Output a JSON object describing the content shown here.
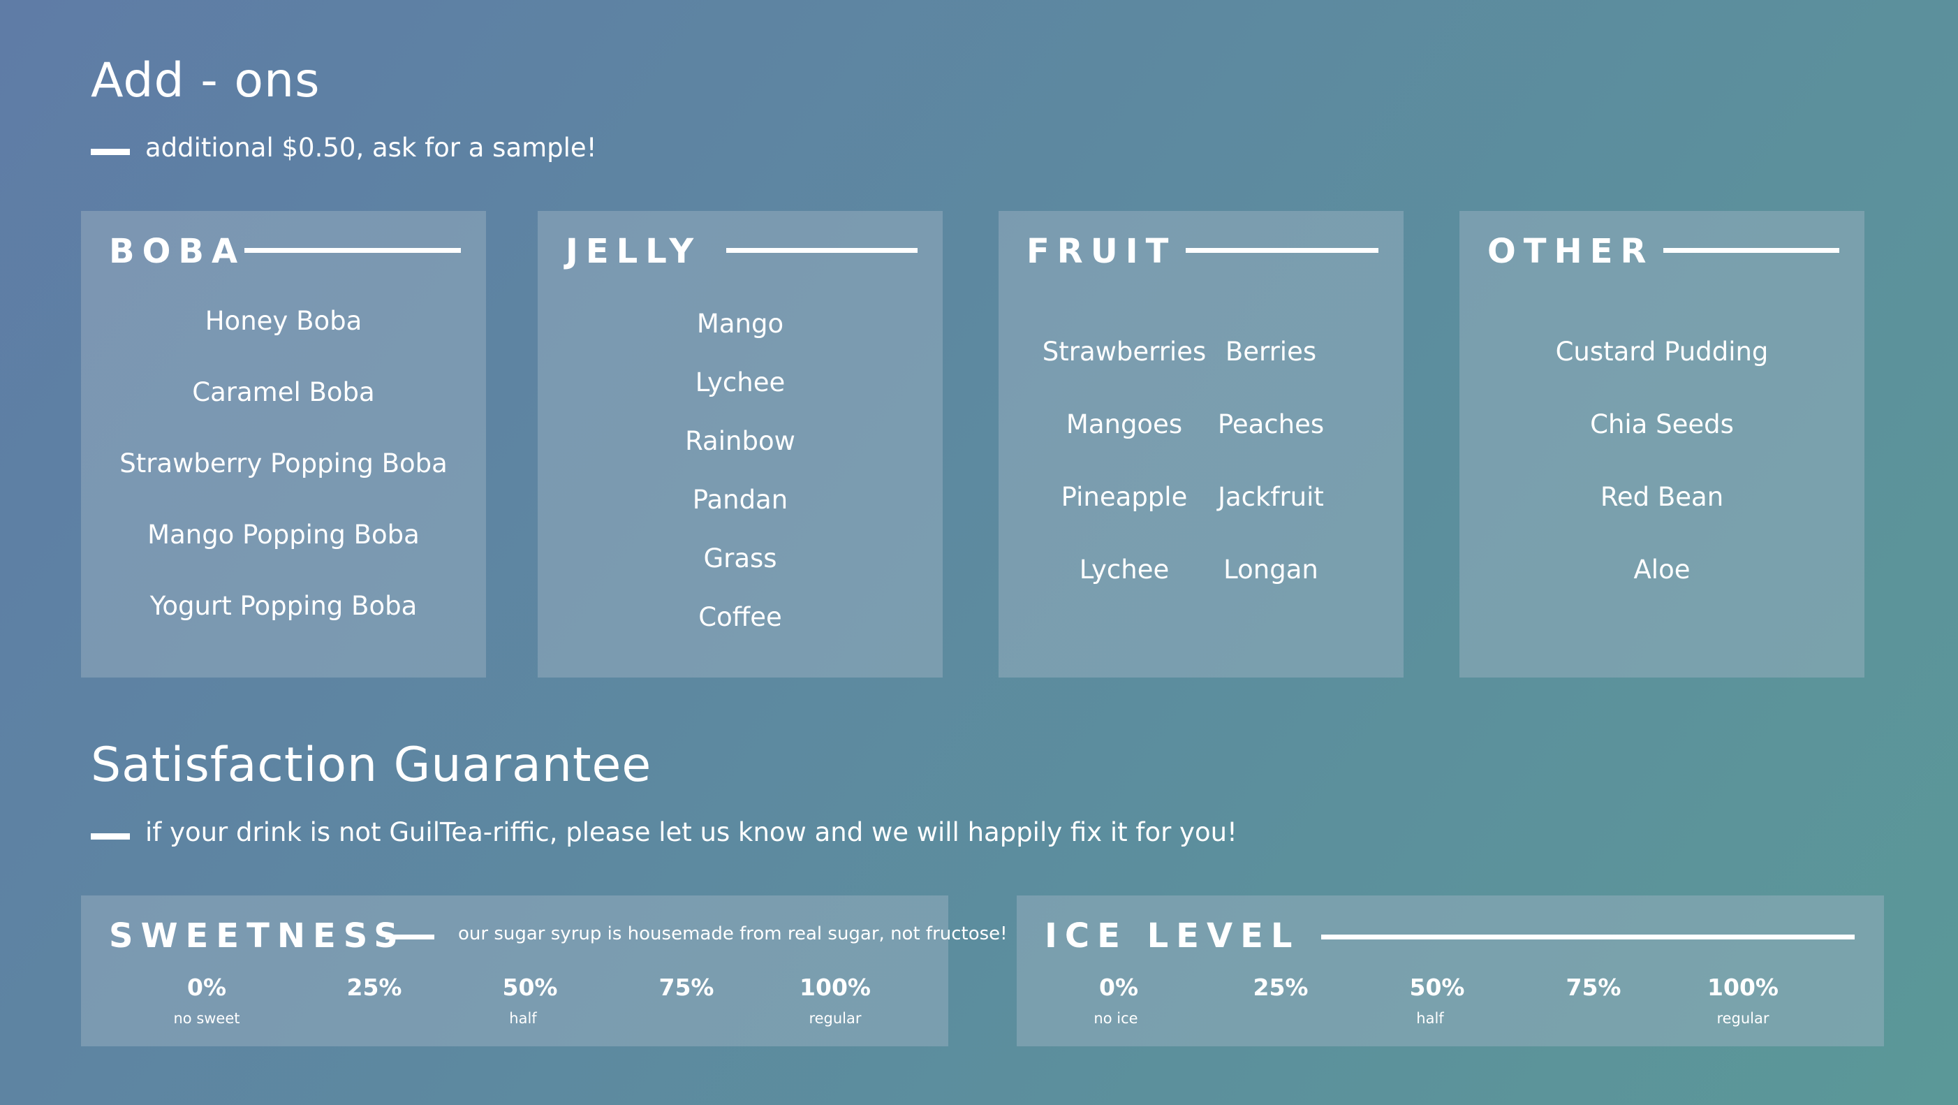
{
  "addons": {
    "title": "Add - ons",
    "subtitle": "additional $0.50, ask for a sample!",
    "categories": {
      "boba": {
        "title": "BOBA",
        "items": [
          "Honey Boba",
          "Caramel Boba",
          "Strawberry Popping Boba",
          "Mango Popping Boba",
          "Yogurt Popping Boba"
        ]
      },
      "jelly": {
        "title": "JELLY",
        "items": [
          "Mango",
          "Lychee",
          "Rainbow",
          "Pandan",
          "Grass",
          "Coffee"
        ]
      },
      "fruit": {
        "title": "FRUIT",
        "items": [
          "Strawberries",
          "Berries",
          "Mangoes",
          "Peaches",
          "Pineapple",
          "Jackfruit",
          "Lychee",
          "Longan"
        ]
      },
      "other": {
        "title": "OTHER",
        "items": [
          "Custard Pudding",
          "Chia Seeds",
          "Red Bean",
          "Aloe"
        ]
      }
    }
  },
  "guarantee": {
    "title": "Satisfaction Guarantee",
    "subtitle": "if your drink is not GuilTea-riffic, please let us know and we will happily fix it for you!"
  },
  "sweetness": {
    "title": "SWEETNESS",
    "note": "our sugar syrup is housemade from real sugar, not fructose!",
    "levels": [
      {
        "value": "0%",
        "caption": "no sweet"
      },
      {
        "value": "25%",
        "caption": ""
      },
      {
        "value": "50%",
        "caption": "half"
      },
      {
        "value": "75%",
        "caption": ""
      },
      {
        "value": "100%",
        "caption": "regular"
      }
    ]
  },
  "ice": {
    "title": "ICE LEVEL",
    "levels": [
      {
        "value": "0%",
        "caption": "no ice"
      },
      {
        "value": "25%",
        "caption": ""
      },
      {
        "value": "50%",
        "caption": "half"
      },
      {
        "value": "75%",
        "caption": ""
      },
      {
        "value": "100%",
        "caption": "regular"
      }
    ]
  }
}
